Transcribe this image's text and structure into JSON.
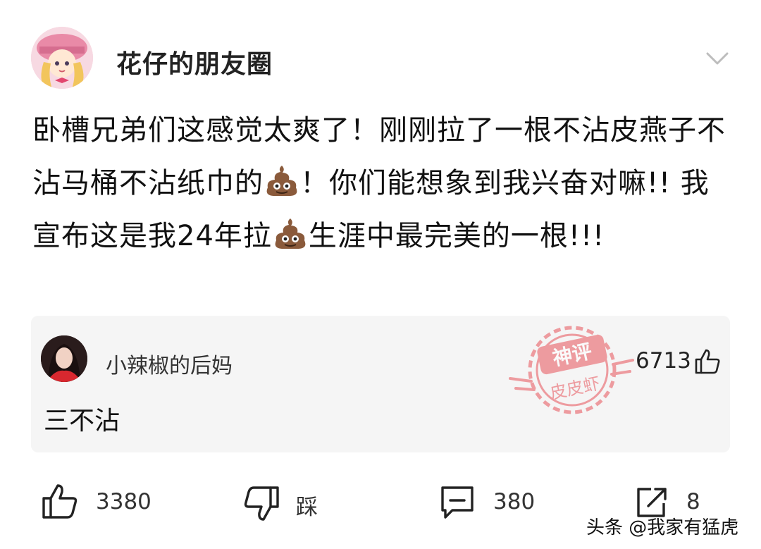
{
  "post": {
    "username": "花仔的朋友圈",
    "text_parts": [
      "卧槽兄弟们这感觉太爽了！刚刚拉了一根不沾皮燕子不沾马桶不沾纸巾的",
      "！你们能想象到我兴奋对嘛!! 我宣布这是我24年拉",
      "生涯中最完美的一根!!!"
    ],
    "emoji": "pile-of-poo"
  },
  "comment": {
    "username": "小辣椒的后妈",
    "text": "三不沾",
    "likes": "6713",
    "badge": {
      "line1": "神评",
      "line2": "皮皮虾"
    }
  },
  "actions": {
    "like_count": "3380",
    "dislike_label": "踩",
    "comment_count": "380",
    "share_count": "8"
  },
  "watermark": "头条 @我家有猛虎",
  "colors": {
    "badge": "#e8535a",
    "icon": "#222222",
    "card_bg": "#f5f5f5"
  }
}
